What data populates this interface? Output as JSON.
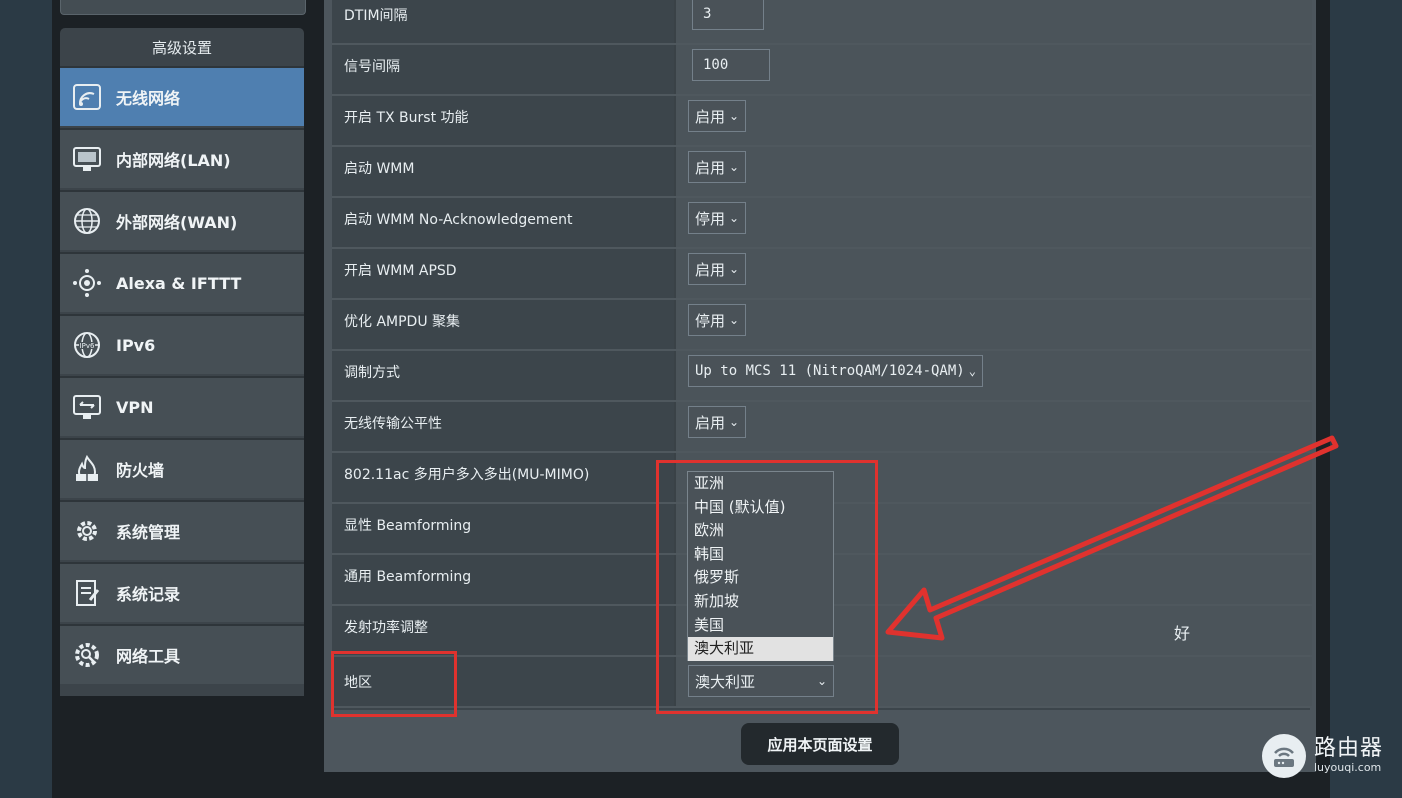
{
  "sidebar": {
    "title": "高级设置",
    "items": [
      {
        "label": "无线网络",
        "icon": "wifi-icon",
        "active": true
      },
      {
        "label": "内部网络(LAN)",
        "icon": "monitor-icon"
      },
      {
        "label": "外部网络(WAN)",
        "icon": "globe-icon"
      },
      {
        "label": "Alexa & IFTTT",
        "icon": "alexa-icon"
      },
      {
        "label": "IPv6",
        "icon": "ipv6-globe-icon"
      },
      {
        "label": "VPN",
        "icon": "vpn-icon"
      },
      {
        "label": "防火墙",
        "icon": "firewall-icon"
      },
      {
        "label": "系统管理",
        "icon": "gear-icon"
      },
      {
        "label": "系统记录",
        "icon": "log-icon"
      },
      {
        "label": "网络工具",
        "icon": "tools-icon"
      }
    ]
  },
  "settings": {
    "rows": [
      {
        "label": "DTIM间隔",
        "type": "input",
        "value": "3"
      },
      {
        "label": "信号间隔",
        "type": "input",
        "value": "100"
      },
      {
        "label": "开启 TX Burst 功能",
        "type": "select",
        "value": "启用"
      },
      {
        "label": "启动 WMM",
        "type": "select",
        "value": "启用"
      },
      {
        "label": "启动 WMM No-Acknowledgement",
        "type": "select",
        "value": "停用"
      },
      {
        "label": "开启 WMM APSD",
        "type": "select",
        "value": "启用"
      },
      {
        "label": "优化 AMPDU 聚集",
        "type": "select",
        "value": "停用"
      },
      {
        "label": "调制方式",
        "type": "select",
        "value": "Up to MCS 11 (NitroQAM/1024-QAM)"
      },
      {
        "label": "无线传输公平性",
        "type": "select",
        "value": "启用"
      },
      {
        "label": "802.11ac 多用户多入多出(MU-MIMO)",
        "type": "select",
        "value": ""
      },
      {
        "label": "显性 Beamforming",
        "type": "select",
        "value": ""
      },
      {
        "label": "通用 Beamforming",
        "type": "select",
        "value": ""
      },
      {
        "label": "发射功率调整",
        "type": "text",
        "value": "好"
      },
      {
        "label": "地区",
        "type": "select",
        "value": "澳大利亚"
      }
    ]
  },
  "region_dropdown": {
    "options": [
      "亚洲",
      "中国 (默认值)",
      "欧洲",
      "韩国",
      "俄罗斯",
      "新加坡",
      "美国",
      "澳大利亚"
    ],
    "selected": "澳大利亚"
  },
  "apply_button": "应用本页面设置",
  "watermark": {
    "title": "路由器",
    "url": "luyouqi.com"
  },
  "colors": {
    "highlight": "#e0322e",
    "active_item": "#4f7fb0"
  }
}
